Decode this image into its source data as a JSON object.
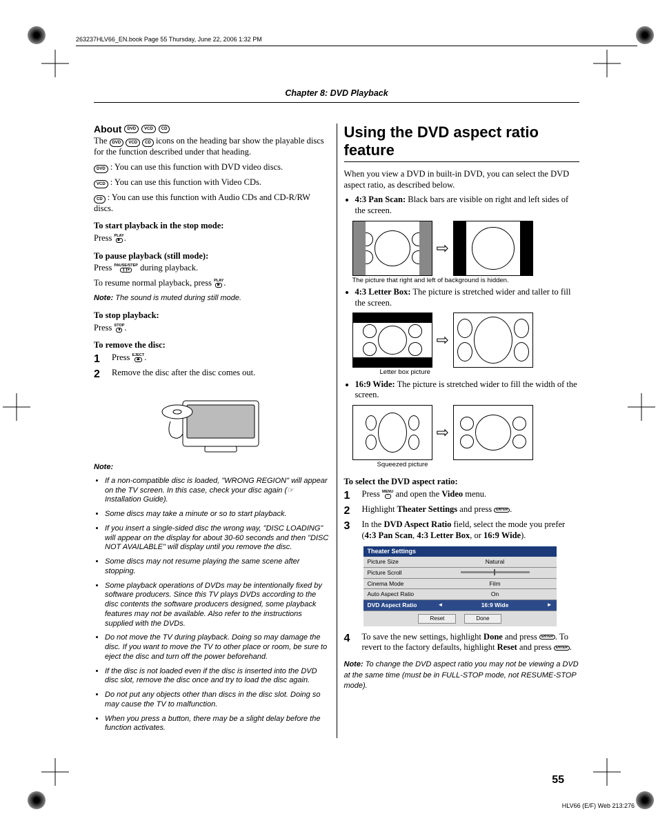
{
  "header_path": "263237HLV66_EN.book  Page 55  Thursday, June 22, 2006  1:32 PM",
  "chapter": "Chapter 8: DVD Playback",
  "page_num": "55",
  "footer_code": "HLV66 (E/F) Web 213:276",
  "left": {
    "about_title": "About",
    "about_intro": "The ⬭ ⬭ ⬭ icons on the heading bar show the playable discs for the function described under that heading.",
    "dvd_line": " : You can use this function with DVD video discs.",
    "vcd_line": " : You can use this function with Video CDs.",
    "cd_line": " : You can use this function with Audio CDs and CD-R/RW discs.",
    "start_h": "To start playback in the stop mode:",
    "start_p": "Press ",
    "pause_h": "To pause playback (still mode):",
    "pause_p1": "Press ",
    "pause_p1b": " during playback.",
    "pause_p2": "To resume normal playback, press ",
    "pause_note": "The sound is muted during still mode.",
    "stop_h": "To stop playback:",
    "stop_p": "Press ",
    "remove_h": "To remove the disc:",
    "remove_1": "Press ",
    "remove_2": "Remove the disc after the disc comes out.",
    "note_label": "Note:",
    "notes": [
      "If a non-compatible disc is loaded, \"WRONG REGION\" will appear on the TV screen. In this case, check your disc again (☞ Installation Guide).",
      "Some discs may take a minute or so to start playback.",
      "If you insert a single-sided disc the wrong way, \"DISC LOADING\" will appear on the display for about 30-60 seconds and then \"DISC NOT AVAILABLE\" will display until you remove the disc.",
      "Some discs may not resume playing the same scene after stopping.",
      "Some playback operations of DVDs may be intentionally fixed by software producers. Since this TV plays DVDs according to the disc contents the software producers designed, some playback features may not be available. Also refer to the instructions supplied with the DVDs.",
      "Do not move the TV during playback. Doing so may damage the disc. If you want to move the TV to other place or room, be sure to eject the disc and turn off the power beforehand.",
      "If the disc is not loaded even if the disc is inserted into the DVD disc slot, remove the disc once and try to load the disc again.",
      "Do not put any objects other than discs in the disc slot. Doing so may cause the TV to malfunction.",
      "When you press a button, there may be a slight delay before the function activates."
    ]
  },
  "right": {
    "title": "Using the DVD aspect ratio feature",
    "intro": "When you view a DVD in built-in DVD, you can select the DVD aspect ratio, as described below.",
    "panscan_label": "4:3 Pan Scan:",
    "panscan_text": " Black bars are visible on right and left sides of the screen.",
    "panscan_caption": "The picture that right and left of background is hidden.",
    "letterbox_label": "4:3 Letter Box:",
    "letterbox_text": " The picture is stretched wider and taller to fill the screen.",
    "letterbox_caption": "Letter box picture",
    "wide_label": "16:9 Wide:",
    "wide_text": " The picture is stretched wider to fill the width of the screen.",
    "wide_caption": "Squeezed picture",
    "select_h": "To select the DVD aspect ratio:",
    "step1a": "Press ",
    "step1b": " and open the ",
    "step1c": "Video",
    "step1d": " menu.",
    "step2a": "Highlight ",
    "step2b": "Theater Settings",
    "step2c": " and press ",
    "step3a": "In the ",
    "step3b": "DVD Aspect Ratio",
    "step3c": " field, select the mode you prefer (",
    "step3d": "4:3 Pan Scan",
    "step3e": ", ",
    "step3f": "4:3 Letter Box",
    "step3g": ", or ",
    "step3h": "16:9 Wide",
    "step3i": ").",
    "step4a": "To save the new settings, highlight ",
    "step4b": "Done",
    "step4c": " and press ",
    "step4d": ". To revert to the factory defaults, highlight ",
    "step4e": "Reset",
    "step4f": " and press ",
    "final_note": "To change the DVD aspect ratio you may not be viewing a DVD at the same time (must be in FULL-STOP mode, not RESUME-STOP mode).",
    "settings": {
      "title": "Theater Settings",
      "rows": [
        {
          "lbl": "Picture Size",
          "val": "Natural"
        },
        {
          "lbl": "Picture Scroll",
          "val": ""
        },
        {
          "lbl": "Cinema Mode",
          "val": "Film"
        },
        {
          "lbl": "Auto Aspect Ratio",
          "val": "On"
        },
        {
          "lbl": "DVD Aspect Ratio",
          "val": "16:9 Wide"
        }
      ],
      "reset": "Reset",
      "done": "Done"
    }
  },
  "keys": {
    "play": "PLAY",
    "pause": "PAUSE/STEP",
    "stop": "STOP",
    "eject": "EJECT",
    "menu": "MENU",
    "enter": "ENTER"
  },
  "badges": {
    "dvd": "DVD",
    "vcd": "VCD",
    "cd": "CD"
  }
}
